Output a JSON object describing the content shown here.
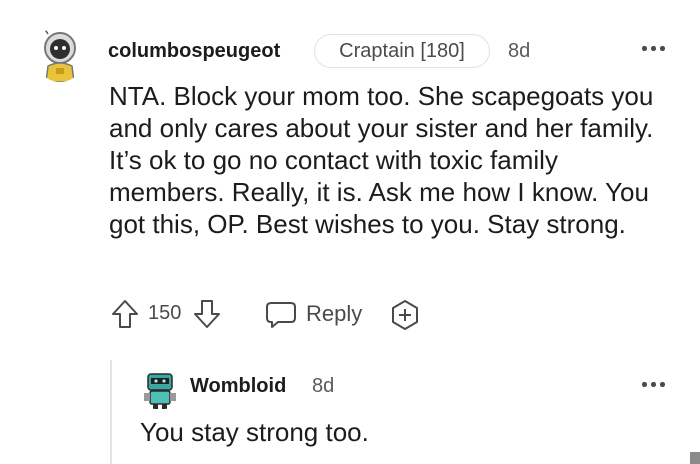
{
  "comment": {
    "username": "columbospeugeot",
    "flair": "Craptain [180]",
    "time": "8d",
    "body": "NTA. Block your mom too. She scapegoats you and only cares about your sister and her family. It’s ok to go no contact with toxic family members. Really, it is. Ask me how I know. You got this, OP. Best wishes to you. Stay strong.",
    "score": "150",
    "reply_label": "Reply",
    "icons": {
      "avatar": "astronaut-avatar",
      "upvote": "arrow-up-icon",
      "downvote": "arrow-down-icon",
      "reply": "speech-bubble-icon",
      "award": "plus-award-icon",
      "more": "more-options-icon"
    }
  },
  "reply": {
    "username": "Wombloid",
    "time": "8d",
    "body": "You stay strong too.",
    "icons": {
      "avatar": "robot-avatar",
      "more": "more-options-icon"
    }
  },
  "colors": {
    "text": "#1c1c1c",
    "muted": "#5a5a5a",
    "border": "#e1e1e1",
    "icon": "#4a4a4a"
  }
}
